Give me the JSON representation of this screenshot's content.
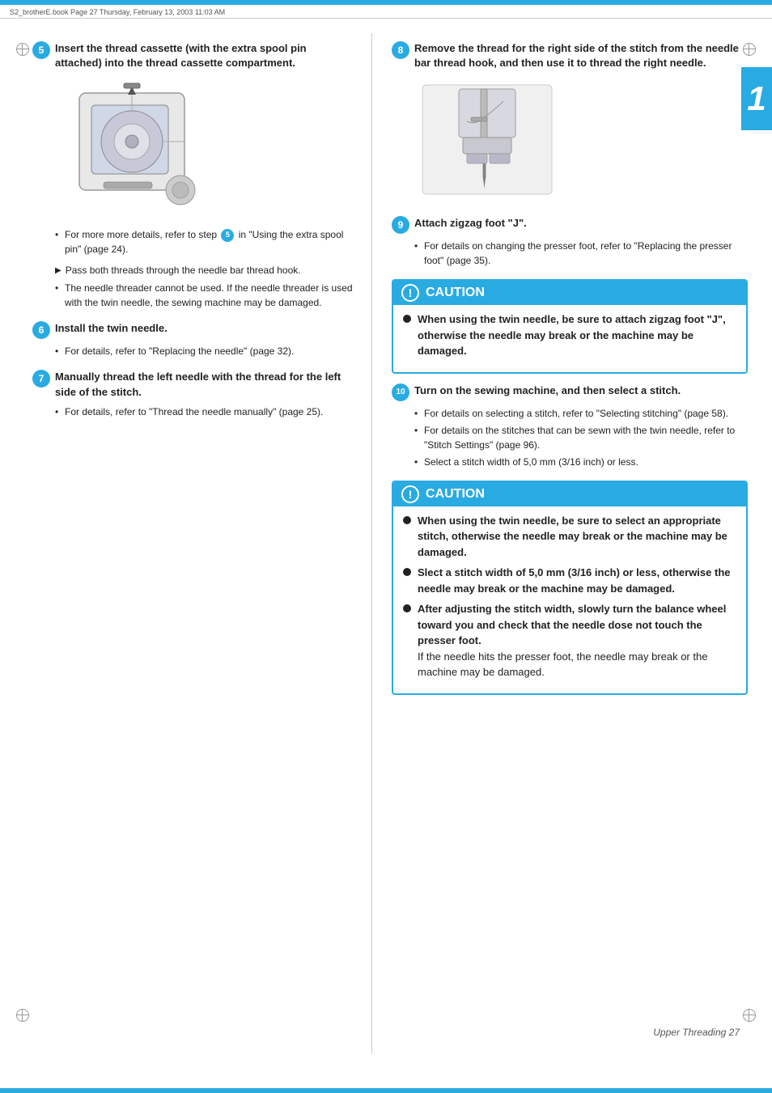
{
  "page": {
    "file_label": "S2_brotherE.book  Page 27  Thursday, February 13, 2003  11:03 AM",
    "chapter_number": "1",
    "footer_text": "Upper Threading    27",
    "accent_color": "#29abe2"
  },
  "steps": {
    "step5": {
      "number": "5",
      "heading": "Insert the thread cassette (with the extra spool pin attached) into the thread cassette compartment.",
      "bullets": [
        "For more details, refer to step  in \"Using the extra spool pin\" (page 24)."
      ],
      "arrow_text": "Pass both threads through the needle bar thread hook.",
      "extra_bullets": [
        "The needle threader cannot be used. If the needle threader is used with the twin needle, the sewing machine may be damaged."
      ]
    },
    "step6": {
      "number": "6",
      "heading": "Install the twin needle.",
      "bullets": [
        "For details, refer to \"Replacing the needle\" (page 32)."
      ]
    },
    "step7": {
      "number": "7",
      "heading": "Manually thread the left needle with the thread for the left side of the stitch.",
      "bullets": [
        "For details, refer to \"Thread the needle manually\" (page 25)."
      ]
    },
    "step8": {
      "number": "8",
      "heading": "Remove the thread for the right side of the stitch from the needle bar thread hook, and then use it to thread the right needle."
    },
    "step9": {
      "number": "9",
      "heading": "Attach zigzag foot \"J\".",
      "bullets": [
        "For details on changing the presser foot, refer to \"Replacing the presser foot\" (page 35)."
      ]
    },
    "step10": {
      "number": "10",
      "heading": "Turn on the sewing machine, and then select a stitch.",
      "bullets": [
        "For details on selecting a stitch, refer to \"Selecting stitching\" (page 58).",
        "For details on the stitches that can be sewn with the twin needle, refer to \"Stitch Settings\" (page 96).",
        "Select a stitch width of 5,0 mm (3/16 inch) or less."
      ]
    }
  },
  "caution_boxes": {
    "caution1": {
      "label": "CAUTION",
      "bullets": [
        "When using the twin needle, be sure to attach zigzag foot \"J\", otherwise the needle may break or the machine may be damaged."
      ]
    },
    "caution2": {
      "label": "CAUTION",
      "bullets": [
        "When using the twin needle, be sure to select an appropriate stitch, otherwise the needle may break or the machine may be damaged.",
        "Slect a stitch width of 5,0 mm (3/16 inch) or less, otherwise the needle may break or the machine may be damaged.",
        "After adjusting the stitch width, slowly turn the balance wheel toward you and check that the needle dose not touch the presser foot.\nIf the needle hits the presser foot, the needle may break or the machine may be damaged."
      ]
    }
  }
}
